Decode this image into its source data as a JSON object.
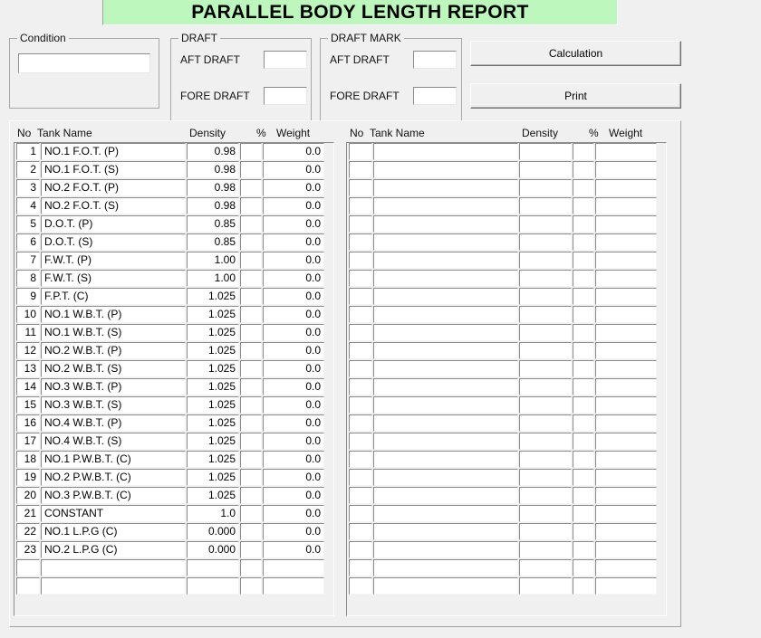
{
  "window": {
    "title": "PARALLEL BODY LENGTH REPORT",
    "banner_color": "#bdf7bd",
    "background_color": "#f0f0f0"
  },
  "condition_group": {
    "legend": "Condition",
    "input_value": "",
    "input_placeholder": ""
  },
  "draft_group": {
    "legend": "DRAFT",
    "fields": [
      {
        "label": "AFT DRAFT",
        "value": ""
      },
      {
        "label": "FORE DRAFT",
        "value": ""
      }
    ]
  },
  "draft_mark_group": {
    "legend": "DRAFT MARK",
    "fields": [
      {
        "label": "AFT DRAFT",
        "value": ""
      },
      {
        "label": "FORE DRAFT",
        "value": ""
      }
    ]
  },
  "buttons": {
    "calculation": "Calculation",
    "print": "Print"
  },
  "grid_columns": [
    "No",
    "Tank Name",
    "Density",
    "%",
    "Weight"
  ],
  "left_grid": {
    "rows": [
      {
        "no": "1",
        "name": "NO.1 F.O.T. (P)",
        "density": "0.98",
        "pct": "",
        "weight": "0.0"
      },
      {
        "no": "2",
        "name": "NO.1 F.O.T. (S)",
        "density": "0.98",
        "pct": "",
        "weight": "0.0"
      },
      {
        "no": "3",
        "name": "NO.2 F.O.T. (P)",
        "density": "0.98",
        "pct": "",
        "weight": "0.0"
      },
      {
        "no": "4",
        "name": "NO.2 F.O.T. (S)",
        "density": "0.98",
        "pct": "",
        "weight": "0.0"
      },
      {
        "no": "5",
        "name": "D.O.T. (P)",
        "density": "0.85",
        "pct": "",
        "weight": "0.0"
      },
      {
        "no": "6",
        "name": "D.O.T. (S)",
        "density": "0.85",
        "pct": "",
        "weight": "0.0"
      },
      {
        "no": "7",
        "name": "F.W.T. (P)",
        "density": "1.00",
        "pct": "",
        "weight": "0.0"
      },
      {
        "no": "8",
        "name": "F.W.T. (S)",
        "density": "1.00",
        "pct": "",
        "weight": "0.0"
      },
      {
        "no": "9",
        "name": "F.P.T. (C)",
        "density": "1.025",
        "pct": "",
        "weight": "0.0"
      },
      {
        "no": "10",
        "name": "NO.1 W.B.T. (P)",
        "density": "1.025",
        "pct": "",
        "weight": "0.0"
      },
      {
        "no": "11",
        "name": "NO.1 W.B.T. (S)",
        "density": "1.025",
        "pct": "",
        "weight": "0.0"
      },
      {
        "no": "12",
        "name": "NO.2 W.B.T. (P)",
        "density": "1.025",
        "pct": "",
        "weight": "0.0"
      },
      {
        "no": "13",
        "name": "NO.2 W.B.T. (S)",
        "density": "1.025",
        "pct": "",
        "weight": "0.0"
      },
      {
        "no": "14",
        "name": "NO.3 W.B.T. (P)",
        "density": "1.025",
        "pct": "",
        "weight": "0.0"
      },
      {
        "no": "15",
        "name": "NO.3 W.B.T. (S)",
        "density": "1.025",
        "pct": "",
        "weight": "0.0"
      },
      {
        "no": "16",
        "name": "NO.4 W.B.T. (P)",
        "density": "1.025",
        "pct": "",
        "weight": "0.0"
      },
      {
        "no": "17",
        "name": "NO.4 W.B.T. (S)",
        "density": "1.025",
        "pct": "",
        "weight": "0.0"
      },
      {
        "no": "18",
        "name": "NO.1 P.W.B.T. (C)",
        "density": "1.025",
        "pct": "",
        "weight": "0.0"
      },
      {
        "no": "19",
        "name": "NO.2 P.W.B.T. (C)",
        "density": "1.025",
        "pct": "",
        "weight": "0.0"
      },
      {
        "no": "20",
        "name": "NO.3 P.W.B.T. (C)",
        "density": "1.025",
        "pct": "",
        "weight": "0.0"
      },
      {
        "no": "21",
        "name": "CONSTANT",
        "density": "1.0",
        "pct": "",
        "weight": "0.0"
      },
      {
        "no": "22",
        "name": "NO.1 L.P.G (C)",
        "density": "0.000",
        "pct": "",
        "weight": "0.0"
      },
      {
        "no": "23",
        "name": "NO.2 L.P.G (C)",
        "density": "0.000",
        "pct": "",
        "weight": "0.0"
      },
      {
        "no": "",
        "name": "",
        "density": "",
        "pct": "",
        "weight": ""
      },
      {
        "no": "",
        "name": "",
        "density": "",
        "pct": "",
        "weight": ""
      }
    ]
  },
  "right_grid": {
    "rows": [
      {
        "no": "",
        "name": "",
        "density": "",
        "pct": "",
        "weight": ""
      },
      {
        "no": "",
        "name": "",
        "density": "",
        "pct": "",
        "weight": ""
      },
      {
        "no": "",
        "name": "",
        "density": "",
        "pct": "",
        "weight": ""
      },
      {
        "no": "",
        "name": "",
        "density": "",
        "pct": "",
        "weight": ""
      },
      {
        "no": "",
        "name": "",
        "density": "",
        "pct": "",
        "weight": ""
      },
      {
        "no": "",
        "name": "",
        "density": "",
        "pct": "",
        "weight": ""
      },
      {
        "no": "",
        "name": "",
        "density": "",
        "pct": "",
        "weight": ""
      },
      {
        "no": "",
        "name": "",
        "density": "",
        "pct": "",
        "weight": ""
      },
      {
        "no": "",
        "name": "",
        "density": "",
        "pct": "",
        "weight": ""
      },
      {
        "no": "",
        "name": "",
        "density": "",
        "pct": "",
        "weight": ""
      },
      {
        "no": "",
        "name": "",
        "density": "",
        "pct": "",
        "weight": ""
      },
      {
        "no": "",
        "name": "",
        "density": "",
        "pct": "",
        "weight": ""
      },
      {
        "no": "",
        "name": "",
        "density": "",
        "pct": "",
        "weight": ""
      },
      {
        "no": "",
        "name": "",
        "density": "",
        "pct": "",
        "weight": ""
      },
      {
        "no": "",
        "name": "",
        "density": "",
        "pct": "",
        "weight": ""
      },
      {
        "no": "",
        "name": "",
        "density": "",
        "pct": "",
        "weight": ""
      },
      {
        "no": "",
        "name": "",
        "density": "",
        "pct": "",
        "weight": ""
      },
      {
        "no": "",
        "name": "",
        "density": "",
        "pct": "",
        "weight": ""
      },
      {
        "no": "",
        "name": "",
        "density": "",
        "pct": "",
        "weight": ""
      },
      {
        "no": "",
        "name": "",
        "density": "",
        "pct": "",
        "weight": ""
      },
      {
        "no": "",
        "name": "",
        "density": "",
        "pct": "",
        "weight": ""
      },
      {
        "no": "",
        "name": "",
        "density": "",
        "pct": "",
        "weight": ""
      },
      {
        "no": "",
        "name": "",
        "density": "",
        "pct": "",
        "weight": ""
      },
      {
        "no": "",
        "name": "",
        "density": "",
        "pct": "",
        "weight": ""
      },
      {
        "no": "",
        "name": "",
        "density": "",
        "pct": "",
        "weight": ""
      }
    ]
  }
}
